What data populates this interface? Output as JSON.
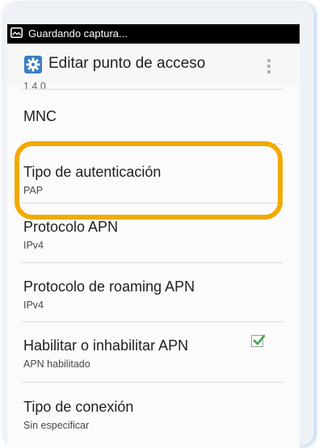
{
  "status_bar": {
    "text": "Guardando captura..."
  },
  "action_bar": {
    "title": "Editar punto de acceso"
  },
  "list": {
    "items": [
      {
        "label": "MNC",
        "value": ""
      },
      {
        "label": "Tipo de autenticación",
        "value": "PAP"
      },
      {
        "label": "Protocolo APN",
        "value": "IPv4"
      },
      {
        "label": "Protocolo de roaming APN",
        "value": "IPv4"
      },
      {
        "label": "Habilitar o inhabilitar APN",
        "value": "APN habilitado",
        "checked": true
      },
      {
        "label": "Tipo de conexión",
        "value": "Sin especificar"
      }
    ]
  },
  "colors": {
    "highlight": "#f2a900",
    "checkbox_check": "#3aa843",
    "app_icon": "#3a7fc0"
  }
}
